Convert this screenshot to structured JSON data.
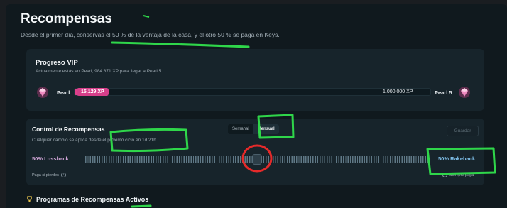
{
  "page": {
    "title": "Recompensas",
    "subtitle": "Desde el primer día, conservas el 50 % de la ventaja de la casa, y el otro 50 % se paga en Keys."
  },
  "vip": {
    "title": "Progreso VIP",
    "subtitle": "Actualmente estás en Pearl, 984.871 XP para llegar a Pearl 5.",
    "current_level": "Pearl",
    "next_level": "Pearl 5",
    "current_xp": "15.129 XP",
    "target_xp": "1.000.000 XP",
    "progress_fraction": 0.015,
    "icon_left": "pink-gem-icon",
    "icon_right": "pink-gem-icon"
  },
  "control": {
    "title": "Control de Recompensas",
    "subtitle": "Cualquier cambio se aplica desde el próximo ciclo en 1d 21h",
    "toggle_options": [
      "Semanal",
      "Mensual"
    ],
    "toggle_selected": "Mensual",
    "save_label": "Guardar",
    "left_label": "50% Lossback",
    "right_label": "50% Rakeback",
    "slider_value_fraction": 0.5,
    "left_hint": "Paga si pierdes",
    "right_hint": "Siempre paga"
  },
  "programs": {
    "title": "Programas de Recompensas Activos",
    "icon": "trophy-icon"
  },
  "colors": {
    "accent_pink": "#d63f8a",
    "annotation_green": "#2fd64a",
    "annotation_red": "#e52a2a"
  }
}
